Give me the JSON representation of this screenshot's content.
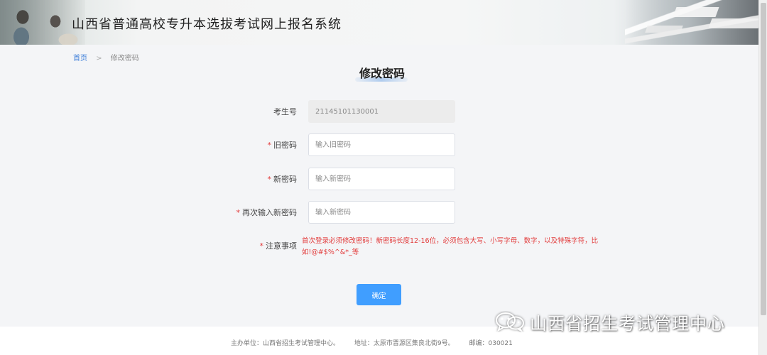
{
  "header": {
    "site_title": "山西省普通高校专升本选拔考试网上报名系统"
  },
  "breadcrumb": {
    "home": "首页",
    "separator": ">",
    "current": "修改密码"
  },
  "page": {
    "heading": "修改密码"
  },
  "form": {
    "exam_number": {
      "label": "考生号",
      "value": "21145101130001"
    },
    "old_password": {
      "required_mark": "*",
      "label": "旧密码",
      "placeholder": "输入旧密码"
    },
    "new_password": {
      "required_mark": "*",
      "label": "新密码",
      "placeholder": "输入新密码"
    },
    "confirm_password": {
      "required_mark": "*",
      "label": "再次输入新密码",
      "placeholder": "输入新密码"
    },
    "notice": {
      "required_mark": "*",
      "label": "注意事项",
      "text": "首次登录必须修改密码！新密码长度12-16位，必须包含大写、小写字母、数字，以及特殊字符，比如!@#$%^&*_等"
    },
    "submit_label": "确定"
  },
  "footer": {
    "organizer": "主办单位：山西省招生考试管理中心。",
    "address": "地址：太原市晋源区集良北街9号。",
    "postcode": "邮编：030021"
  },
  "watermark": {
    "text": "山西省招生考试管理中心",
    "icon": "wechat-icon"
  },
  "colors": {
    "primary": "#409eff",
    "required": "#e23b3b",
    "breadcrumb_link": "#3b7dd8"
  }
}
